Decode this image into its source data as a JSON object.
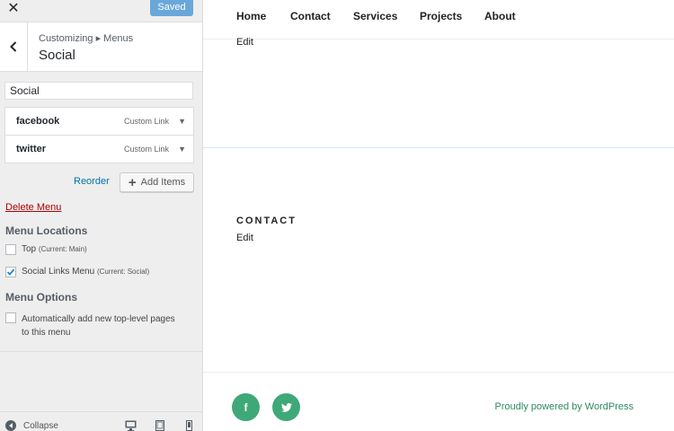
{
  "topbar": {
    "close_glyph": "✕",
    "saved_label": "Saved"
  },
  "section": {
    "breadcrumb": "Customizing ▸ Menus",
    "title": "Social"
  },
  "menu_name": {
    "value": "Social"
  },
  "menu_items": [
    {
      "title": "facebook",
      "type": "Custom Link",
      "toggle": "▼"
    },
    {
      "title": "twitter",
      "type": "Custom Link",
      "toggle": "▼"
    }
  ],
  "actions": {
    "reorder": "Reorder",
    "add_items": "Add Items",
    "plus": "+"
  },
  "delete_menu": "Delete Menu",
  "menu_locations": {
    "heading": "Menu Locations",
    "items": [
      {
        "label": "Top",
        "note": "(Current: Main)",
        "checked": false
      },
      {
        "label": "Social Links Menu",
        "note": "(Current: Social)",
        "checked": true
      }
    ]
  },
  "menu_options": {
    "heading": "Menu Options",
    "auto_add_line1": "Automatically add new top-level pages",
    "auto_add_line2": "to this menu",
    "checked": false
  },
  "footer": {
    "collapse": "Collapse"
  },
  "preview": {
    "nav": [
      "Home",
      "Contact",
      "Services",
      "Projects",
      "About"
    ],
    "edit_top": "Edit",
    "contact_heading": "CONTACT",
    "contact_edit": "Edit",
    "social": {
      "facebook": "f",
      "twitter": "t"
    },
    "powered_by": "Proudly powered by WordPress"
  },
  "colors": {
    "accent": "#0073aa",
    "saved_button": "#6aa7d9",
    "social_green": "#3fa878",
    "delete_red": "#aa0000"
  }
}
